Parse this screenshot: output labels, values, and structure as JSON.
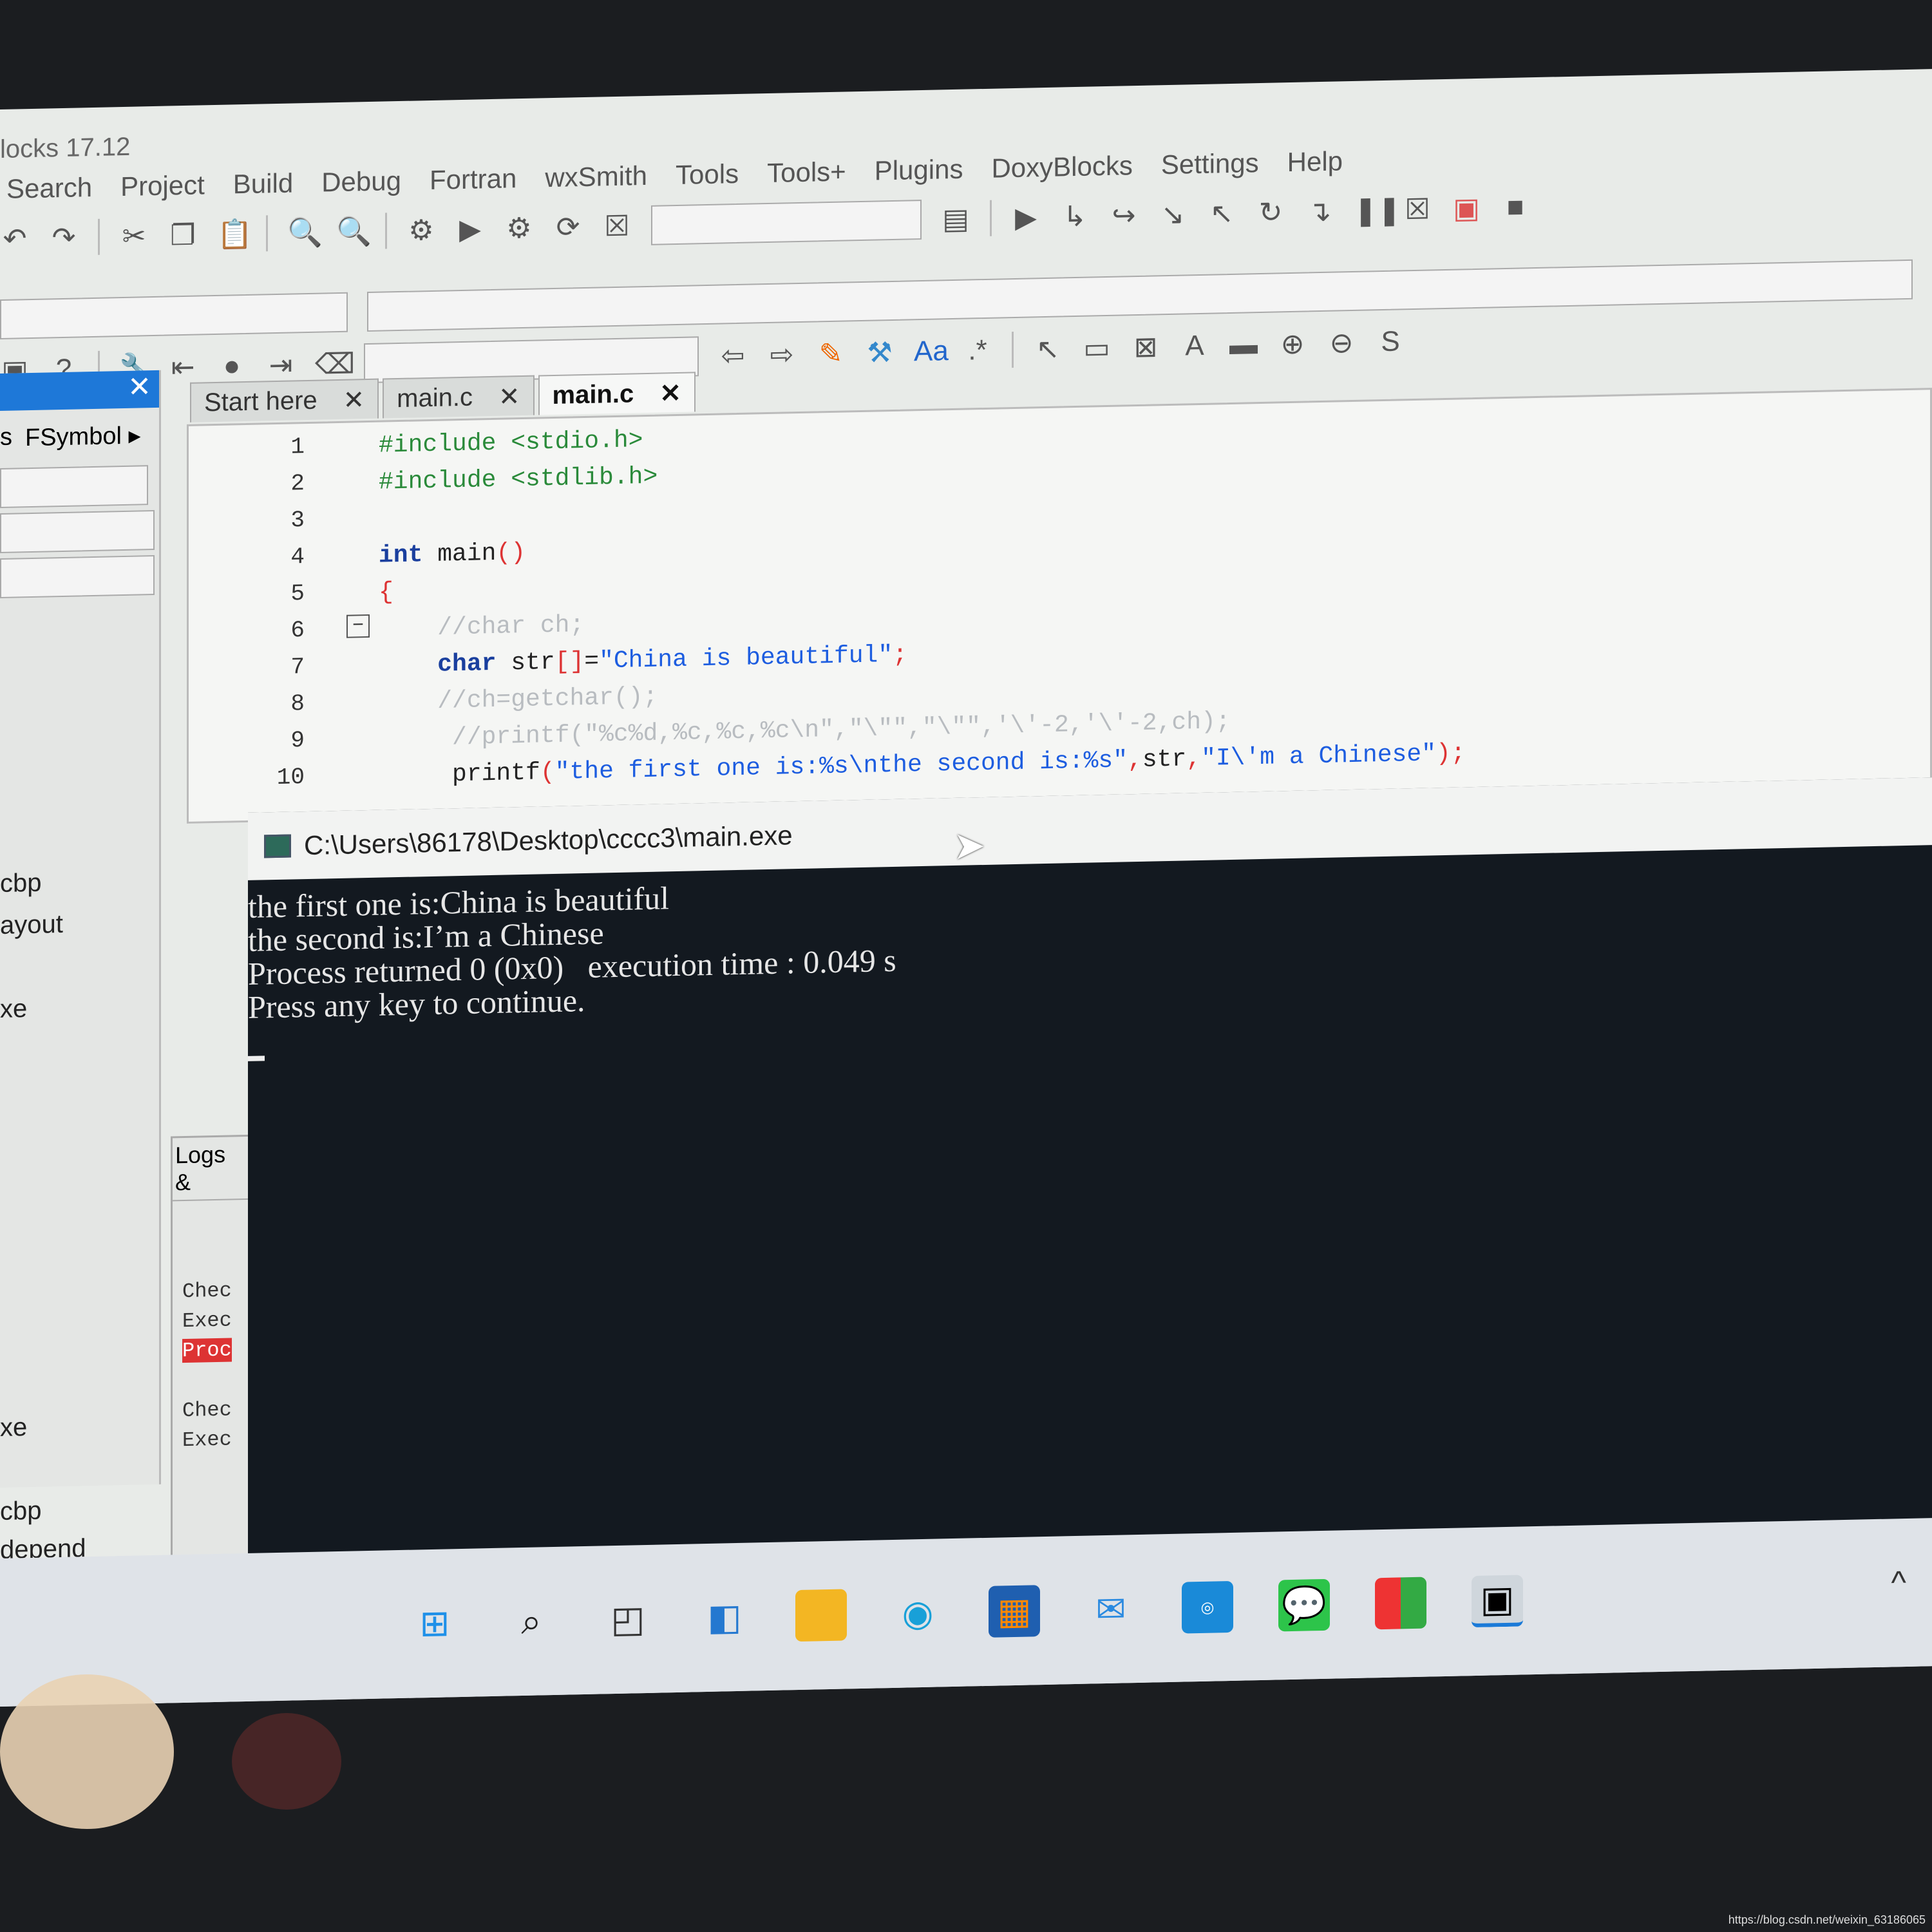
{
  "window": {
    "title": "locks 17.12"
  },
  "menu": [
    "Search",
    "Project",
    "Build",
    "Debug",
    "Fortran",
    "wxSmith",
    "Tools",
    "Tools+",
    "Plugins",
    "DoxyBlocks",
    "Settings",
    "Help"
  ],
  "left_panel": {
    "close": "✕",
    "tabs": [
      "s",
      "FSymbol ▸"
    ],
    "items": [
      "cbp",
      "ayout",
      "xe",
      "xe",
      "cbp",
      "depend"
    ]
  },
  "editor": {
    "tabs": [
      {
        "label": "Start here",
        "close": "✕"
      },
      {
        "label": "main.c",
        "close": "✕"
      },
      {
        "label": "main.c",
        "close": "✕",
        "active": true
      }
    ],
    "lines": [
      {
        "n": "1",
        "parts": [
          [
            "pp",
            "#include <stdio.h>"
          ]
        ]
      },
      {
        "n": "2",
        "parts": [
          [
            "pp",
            "#include <stdlib.h>"
          ]
        ]
      },
      {
        "n": "3",
        "parts": []
      },
      {
        "n": "4",
        "parts": [
          [
            "kw",
            "int"
          ],
          [
            "id",
            " main"
          ],
          [
            "pu",
            "()"
          ]
        ]
      },
      {
        "n": "5",
        "parts": [
          [
            "pu",
            "{"
          ]
        ]
      },
      {
        "n": "6",
        "parts": [
          [
            "cm",
            "    //char ch;"
          ]
        ]
      },
      {
        "n": "7",
        "parts": [
          [
            "kw",
            "    char"
          ],
          [
            "id",
            " str"
          ],
          [
            "pu",
            "[]"
          ],
          [
            "id",
            "="
          ],
          [
            "str",
            "\"China is beautiful\""
          ],
          [
            "pu",
            ";"
          ]
        ]
      },
      {
        "n": "8",
        "parts": [
          [
            "cm",
            "    //ch=getchar();"
          ]
        ]
      },
      {
        "n": "9",
        "parts": [
          [
            "cm",
            "     //printf(\"%c%d,%c,%c,%c\\n\",\"\\\"\",\"\\\"\",'\\'-2,'\\'-2,ch);"
          ]
        ]
      },
      {
        "n": "10",
        "parts": [
          [
            "id",
            "     printf"
          ],
          [
            "pu",
            "("
          ],
          [
            "str",
            "\"the first one is:%s\\nthe second is:%s\""
          ],
          [
            "pu",
            ","
          ],
          [
            "id",
            "str"
          ],
          [
            "pu",
            ","
          ],
          [
            "str",
            "\"I\\'m a Chinese\""
          ],
          [
            "pu",
            ");"
          ]
        ]
      }
    ]
  },
  "logs": {
    "tab": "Logs &",
    "lines": [
      "Chec",
      "Exec",
      "Proc",
      "Chec",
      "Exec"
    ]
  },
  "console": {
    "title": "C:\\Users\\86178\\Desktop\\cccc3\\main.exe",
    "output": [
      "the first one is:China is beautiful",
      "the second is:I’m a Chinese",
      "Process returned 0 (0x0)   execution time : 0.049 s",
      "Press any key to continue."
    ]
  },
  "taskbar": {
    "icons": [
      "windows-start-icon",
      "search-icon",
      "task-view-icon",
      "widgets-icon",
      "file-explorer-icon",
      "edge-icon",
      "store-icon",
      "mail-icon",
      "dell-icon",
      "wechat-icon",
      "office-icon",
      "codeblocks-icon"
    ],
    "tray": "^"
  },
  "watermark": "https://blog.csdn.net/weixin_63186065",
  "colors": {
    "console_bg": "#131920",
    "accent": "#1e78d8",
    "keyword": "#1a3f9e",
    "string": "#1d5de0",
    "preprocessor": "#2a8a3a"
  }
}
